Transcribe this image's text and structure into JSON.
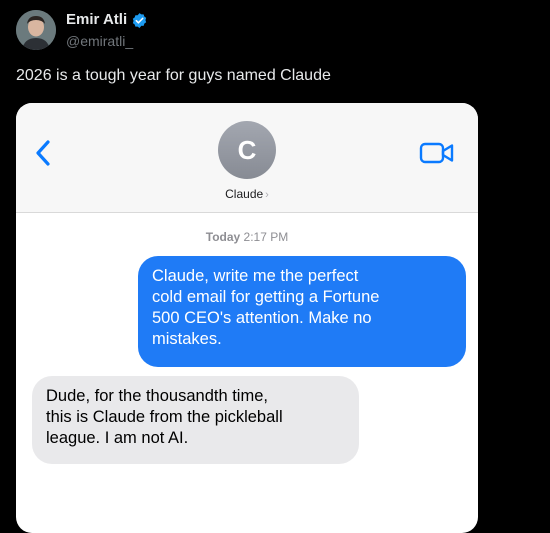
{
  "tweet": {
    "author_name": "Emir Atli",
    "author_handle": "@emiratli_",
    "text": "2026 is a tough year for guys named Claude"
  },
  "imessage": {
    "contact_initial": "C",
    "contact_name": "Claude",
    "timestamp_day": "Today",
    "timestamp_time": "2:17 PM",
    "messages": [
      {
        "direction": "sent",
        "lines": [
          "Claude, write me the perfect",
          "cold email for getting a Fortune",
          "500 CEO's attention. Make no",
          "mistakes."
        ]
      },
      {
        "direction": "received",
        "lines": [
          "Dude, for the thousandth time,",
          "this is Claude from the pickleball",
          "league. I am not AI."
        ]
      }
    ]
  },
  "icons": {
    "verified": "verified-badge-icon",
    "back": "chevron-left-icon",
    "facetime": "video-camera-icon"
  },
  "colors": {
    "background": "#000000",
    "verified_blue": "#1d9bf0",
    "imessage_blue": "#1f7bf6",
    "received_gray": "#e9e9eb",
    "ios_tint": "#0a7aff"
  }
}
